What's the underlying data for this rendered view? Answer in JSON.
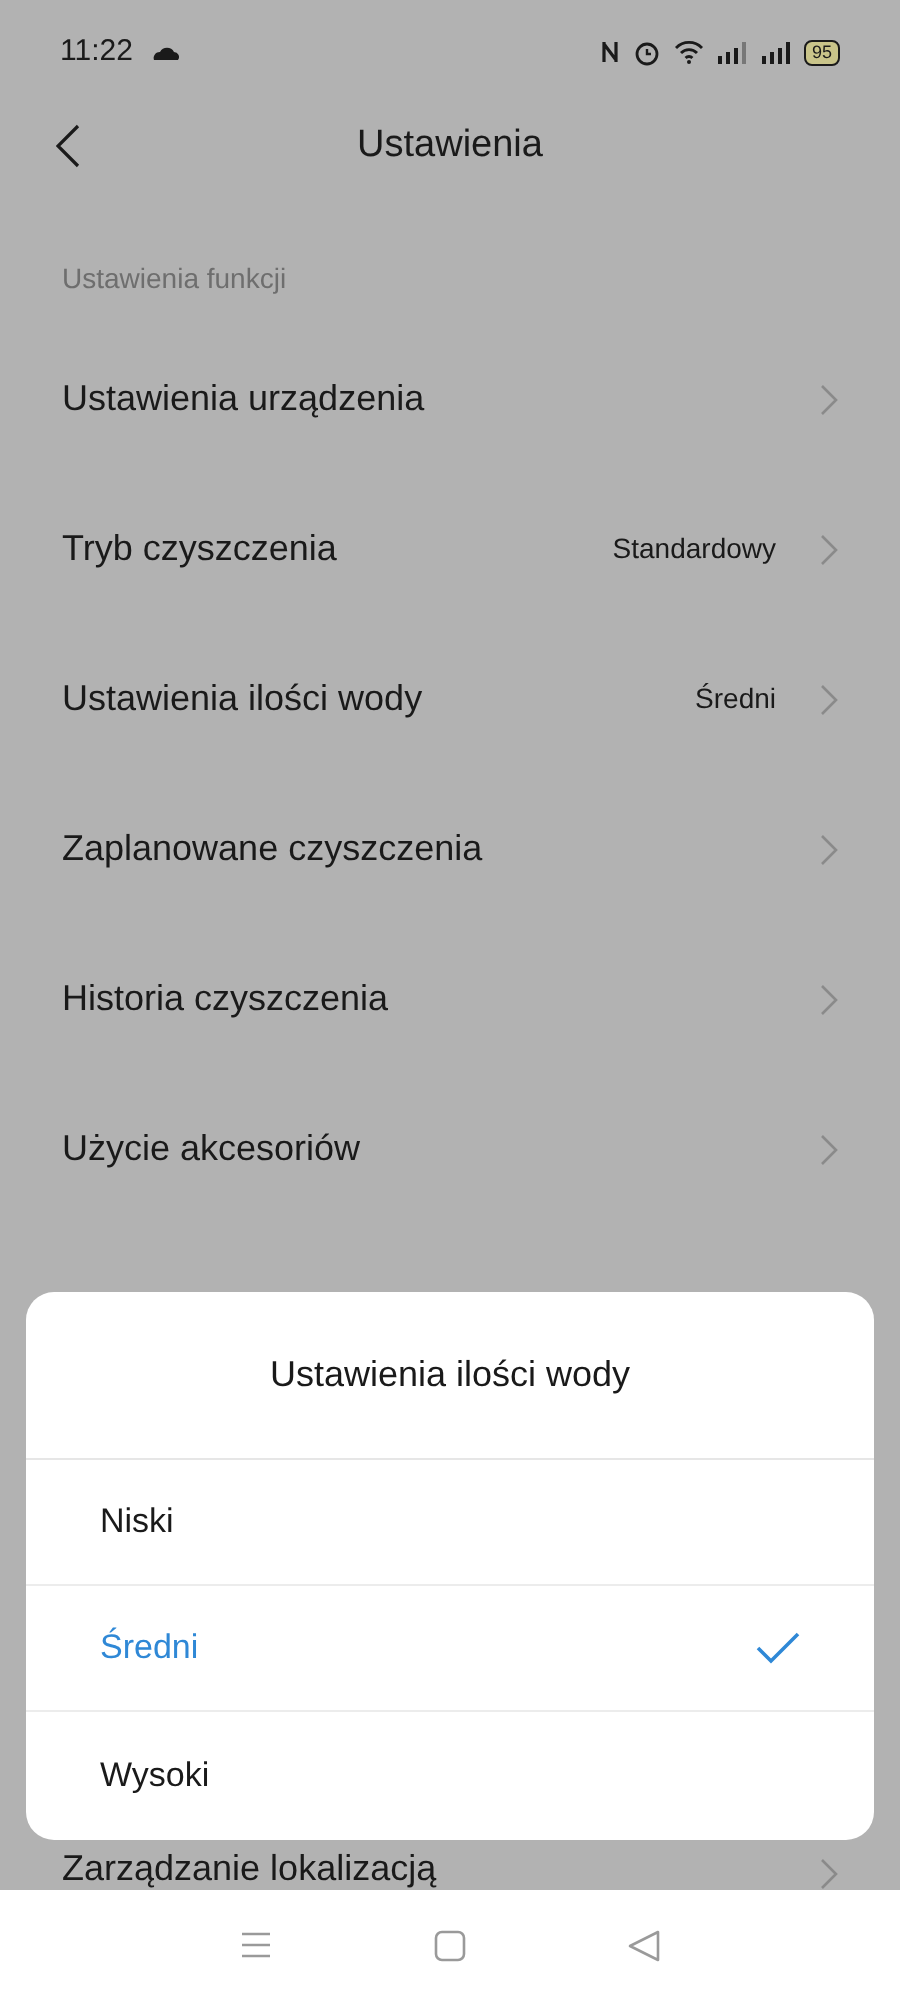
{
  "status_bar": {
    "time": "11:22",
    "battery": "95"
  },
  "header": {
    "title": "Ustawienia"
  },
  "section": {
    "label": "Ustawienia funkcji"
  },
  "rows": [
    {
      "label": "Ustawienia urządzenia"
    },
    {
      "label": "Tryb czyszczenia",
      "value": "Standardowy"
    },
    {
      "label": "Ustawienia ilości wody",
      "value": "Średni"
    },
    {
      "label": "Zaplanowane czyszczenia"
    },
    {
      "label": "Historia czyszczenia"
    },
    {
      "label": "Użycie akcesoriów"
    }
  ],
  "last_row": {
    "label": "Zarządzanie lokalizacją"
  },
  "sheet": {
    "title": "Ustawienia ilości wody",
    "options": [
      {
        "label": "Niski",
        "selected": false
      },
      {
        "label": "Średni",
        "selected": true
      },
      {
        "label": "Wysoki",
        "selected": false
      }
    ]
  }
}
